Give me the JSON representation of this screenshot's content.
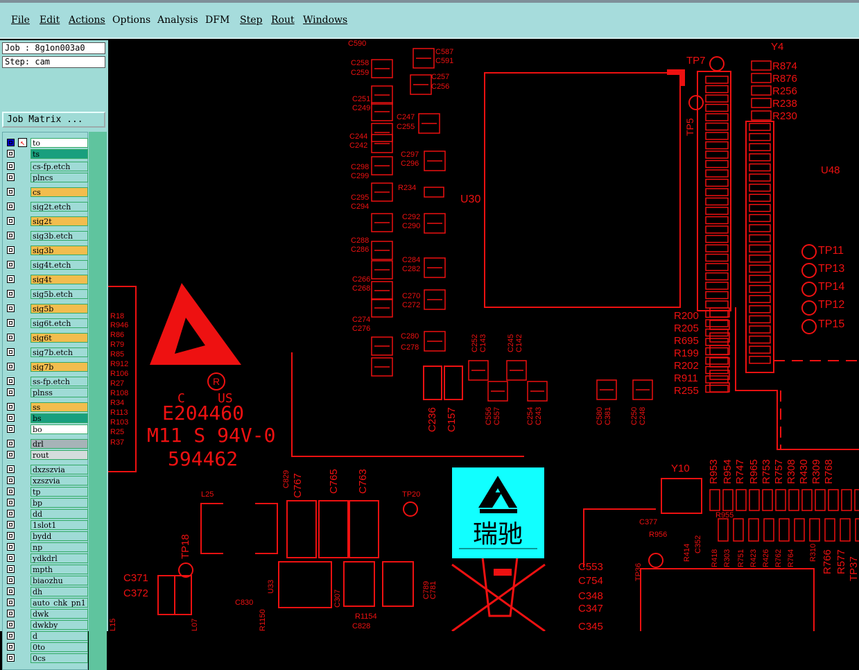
{
  "menu": [
    "File",
    "Edit",
    "Actions",
    "Options",
    "Analysis",
    "DFM",
    "Step",
    "Rout",
    "Windows"
  ],
  "job": {
    "job_label": "Job : 8g1on003a0",
    "step_label": "Step: cam",
    "matrix_button": "Job Matrix ..."
  },
  "layers": [
    {
      "name": "to",
      "color": "#ffffff"
    },
    {
      "name": "ts",
      "color": "#199f7e"
    },
    {
      "name": "cs-fp.etch",
      "color": "#9fdbd6"
    },
    {
      "name": "plncs",
      "color": "#9fdbd6"
    },
    {
      "name": "cs",
      "color": "#f2bd4e"
    },
    {
      "name": "sig2t.etch",
      "color": "#9fdbd6"
    },
    {
      "name": "sig2t",
      "color": "#f2bd4e"
    },
    {
      "name": "sig3b.etch",
      "color": "#9fdbd6"
    },
    {
      "name": "sig3b",
      "color": "#f2bd4e"
    },
    {
      "name": "sig4t.etch",
      "color": "#9fdbd6"
    },
    {
      "name": "sig4t",
      "color": "#f2bd4e"
    },
    {
      "name": "sig5b.etch",
      "color": "#9fdbd6"
    },
    {
      "name": "sig5b",
      "color": "#f2bd4e"
    },
    {
      "name": "sig6t.etch",
      "color": "#9fdbd6"
    },
    {
      "name": "sig6t",
      "color": "#f2bd4e"
    },
    {
      "name": "sig7b.etch",
      "color": "#9fdbd6"
    },
    {
      "name": "sig7b",
      "color": "#f2bd4e"
    },
    {
      "name": "ss-fp.etch",
      "color": "#9fdbd6"
    },
    {
      "name": "plnss",
      "color": "#9fdbd6"
    },
    {
      "name": "ss",
      "color": "#f2bd4e"
    },
    {
      "name": "bs",
      "color": "#199f7e"
    },
    {
      "name": "bo",
      "color": "#ffffff"
    },
    {
      "name": "drl",
      "color": "#a7b3b8"
    },
    {
      "name": "rout",
      "color": "#d4dcdc"
    },
    {
      "name": "dxzszvia",
      "color": "#9fdbd6"
    },
    {
      "name": "xzszvia",
      "color": "#9fdbd6"
    },
    {
      "name": "tp",
      "color": "#9fdbd6"
    },
    {
      "name": "bp",
      "color": "#9fdbd6"
    },
    {
      "name": "dd",
      "color": "#9fdbd6"
    },
    {
      "name": "1slot1",
      "color": "#9fdbd6"
    },
    {
      "name": "bydd",
      "color": "#9fdbd6"
    },
    {
      "name": "np",
      "color": "#9fdbd6"
    },
    {
      "name": "ydkdrl",
      "color": "#9fdbd6"
    },
    {
      "name": "mpth",
      "color": "#9fdbd6"
    },
    {
      "name": "biaozhu",
      "color": "#9fdbd6"
    },
    {
      "name": "dh",
      "color": "#9fdbd6"
    },
    {
      "name": "auto_chk_pn1",
      "color": "#9fdbd6"
    },
    {
      "name": "dwk",
      "color": "#9fdbd6"
    },
    {
      "name": "dwkby",
      "color": "#9fdbd6"
    },
    {
      "name": "d",
      "color": "#9fdbd6"
    },
    {
      "name": "0to",
      "color": "#9fdbd6"
    },
    {
      "name": "0cs",
      "color": "#9fdbd6"
    }
  ],
  "pcb": {
    "trace_color": "#ee1111",
    "logo_bg": "#1ff",
    "ul_text": "E204460",
    "flam_text": "M11 S 94V-0",
    "code_text": "594462",
    "us_text": "US",
    "c_text": "C",
    "logo_chars": "瑞驰",
    "labels_h": [
      "C590",
      "C587",
      "C591",
      "C258",
      "C259",
      "C257",
      "C256",
      "C251",
      "C249",
      "C247",
      "C255",
      "C244",
      "C242",
      "C297",
      "C296",
      "C298",
      "C299",
      "R234",
      "C295",
      "C294",
      "U30",
      "C292",
      "C290",
      "C288",
      "C286",
      "C284",
      "C282",
      "C266",
      "C268",
      "C270",
      "C272",
      "C274",
      "C276",
      "C280",
      "C278",
      "TP7",
      "Y4",
      "R874",
      "R876",
      "R256",
      "R238",
      "R230",
      "U48",
      "TP11",
      "TP13",
      "TP14",
      "TP12",
      "TP15",
      "R200",
      "R205",
      "R695",
      "R199",
      "R202",
      "R911",
      "R255",
      "R18",
      "R946",
      "R86",
      "R79",
      "R85",
      "R912",
      "R106",
      "R27",
      "R108",
      "R34",
      "R113",
      "R103",
      "R25",
      "R37",
      "L25",
      "TP20",
      "Y10",
      "C377",
      "R956",
      "R955",
      "C553",
      "C754",
      "C348",
      "C347",
      "C345",
      "C371",
      "C372",
      "C830",
      "R1154",
      "C828"
    ],
    "labels_v": [
      "TP5",
      "C236",
      "C157",
      "C556",
      "C557",
      "C254",
      "C243",
      "C580",
      "C381",
      "C250",
      "C248",
      "C252",
      "C143",
      "C245",
      "C142",
      "C829",
      "C767",
      "C765",
      "C763",
      "TP18",
      "U33",
      "C307",
      "C789",
      "C781",
      "R953",
      "R954",
      "R747",
      "R965",
      "R753",
      "R757",
      "R308",
      "R430",
      "R309",
      "R768",
      "R418",
      "R303",
      "R751",
      "R423",
      "R426",
      "R762",
      "R764",
      "R310",
      "R766",
      "R577",
      "TP37",
      "TP36",
      "R414",
      "C352",
      "R1150",
      "L15",
      "L07"
    ]
  }
}
